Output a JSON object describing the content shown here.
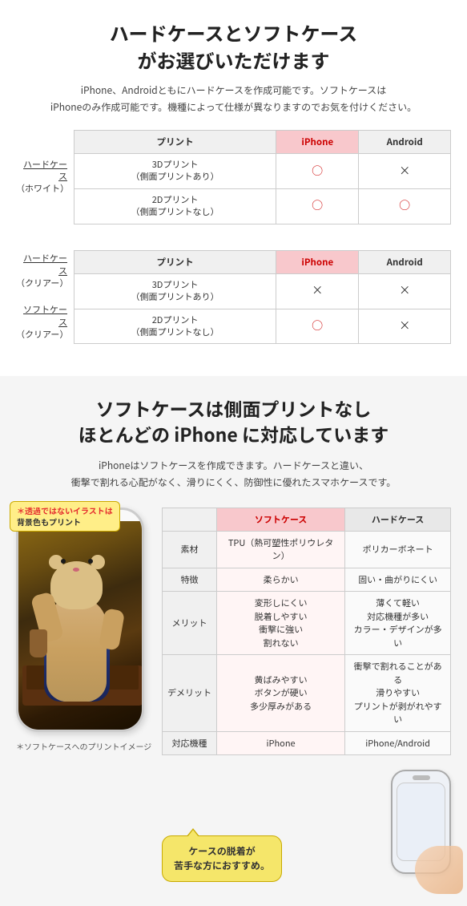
{
  "section1": {
    "title_line1": "ハードケースとソフトケース",
    "title_line2": "がお選びいただけます",
    "subtitle": "iPhone、Androidともにハードケースを作成可能です。ソフトケースは\niPhoneのみ作成可能です。機種によって仕様が異なりますのでお気を付けください。",
    "table1": {
      "header": [
        "プリント",
        "iPhone",
        "Android"
      ],
      "left_label1": "ハードケース\n（ホワイト）",
      "rows": [
        {
          "print": "3Dプリント\n（側面プリントあり）",
          "iphone": "○",
          "android": "×"
        },
        {
          "print": "2Dプリント\n（側面プリントなし）",
          "iphone": "○",
          "android": "○"
        }
      ]
    },
    "table2": {
      "header": [
        "プリント",
        "iPhone",
        "Android"
      ],
      "left_label1": "ハードケース\n（クリアー）",
      "left_label2": "ソフトケース\n（クリアー）",
      "rows": [
        {
          "print": "3Dプリント\n（側面プリントあり）",
          "iphone": "×",
          "android": "×"
        },
        {
          "print": "2Dプリント\n（側面プリントなし）",
          "iphone": "○",
          "android": "×"
        }
      ]
    }
  },
  "section2": {
    "title_line1": "ソフトケースは側面プリントなし",
    "title_line2": "ほとんどの iPhone に対応しています",
    "subtitle": "iPhoneはソフトケースを作成できます。ハードケースと違い、\n衝撃で割れる心配がなく、滑りにくく、防御性に優れたスマホケースです。",
    "sticker_line1": "＊透過ではないイラストは",
    "sticker_line2": "背景色もプリント",
    "phone_caption": "＊ソフトケースへのプリントイメージ",
    "comparison_table": {
      "headers": [
        "",
        "ソフトケース",
        "ハードケース"
      ],
      "rows": [
        {
          "label": "素材",
          "soft": "TPU（熱可塑性ポリウレタン）",
          "hard": "ポリカーボネート"
        },
        {
          "label": "特徴",
          "soft": "柔らかい",
          "hard": "固い・曲がりにくい"
        },
        {
          "label": "メリット",
          "soft": "変形しにくい\n脱着しやすい\n衝撃に強い\n割れない",
          "hard": "薄くて軽い\n対応機種が多い\nカラー・デザインが多い"
        },
        {
          "label": "デメリット",
          "soft": "黄ばみやすい\nボタンが硬い\n多少厚みがある",
          "hard": "衝撃で割れることがある\n滑りやすい\nプリントが剥がれやすい"
        },
        {
          "label": "対応機種",
          "soft": "iPhone",
          "hard": "iPhone/Android"
        }
      ]
    },
    "speech_bubble_line1": "ケースの脱着が",
    "speech_bubble_line2": "苦手な方におすすめ。"
  }
}
